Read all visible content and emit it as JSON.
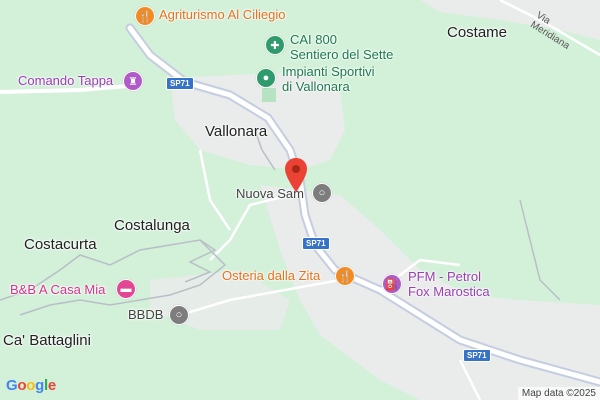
{
  "map": {
    "towns": {
      "vallonara": "Vallonara",
      "costame": "Costame",
      "costalunga": "Costalunga",
      "costacurta": "Costacurta",
      "ca_battaglini": "Ca' Battaglini"
    },
    "street": "Via Meridiana",
    "roads": {
      "sp71_top": "SP71",
      "sp71_mid": "SP71",
      "sp71_bottom": "SP71"
    },
    "pois": {
      "agriturismo": "Agriturismo Al Ciliegio",
      "cai_line1": "CAI 800",
      "cai_line2": "Sentiero del Sette",
      "impianti_line1": "Impianti Sportivi",
      "impianti_line2": "di Vallonara",
      "comando_tappa": "Comando Tappa",
      "nuova_sam": "Nuova Sam",
      "osteria": "Osteria dalla Zita",
      "pfm_line1": "PFM - Petrol",
      "pfm_line2": "Fox Marostica",
      "bnb": "B&B A Casa Mia",
      "bbdb": "BBDB"
    },
    "icons": {
      "restaurant": "restaurant-icon",
      "hiking": "hiking-icon",
      "sports": "sports-icon",
      "castle": "castle-icon",
      "place": "place-icon",
      "fuel": "fuel-icon",
      "hotel": "hotel-icon",
      "pin": "location-pin-icon"
    },
    "colors": {
      "forest": "#d3f0d9",
      "urban": "#e9eceb",
      "road": "#c5cde0",
      "pin": "#ea4335"
    },
    "logo": "Google",
    "attribution": "Map data ©2025"
  }
}
